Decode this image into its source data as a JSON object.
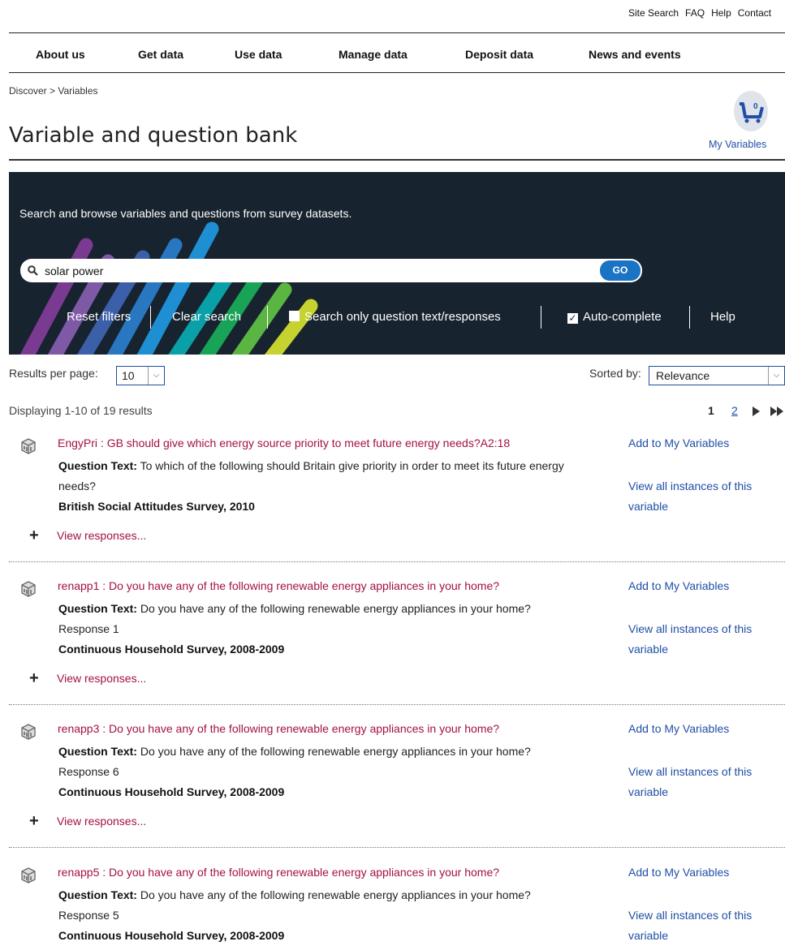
{
  "util_nav": [
    "Site Search",
    "FAQ",
    "Help",
    "Contact"
  ],
  "main_nav": [
    "About us",
    "Get data",
    "Use data",
    "Manage data",
    "Deposit data",
    "News and events"
  ],
  "breadcrumb": "Discover > Variables",
  "page_title": "Variable and question bank",
  "cart": {
    "count": "0",
    "label": "My Variables"
  },
  "banner": {
    "intro": "Search and browse variables and questions from survey datasets."
  },
  "search": {
    "value": "solar power",
    "go_label": "GO"
  },
  "controls": {
    "reset": "Reset filters",
    "clear": "Clear search",
    "question_only": "Search only question text/responses",
    "question_only_checked": false,
    "autocomplete": "Auto-complete",
    "autocomplete_checked": true,
    "help": "Help"
  },
  "results_per_page": {
    "label": "Results per page:",
    "value": "10"
  },
  "sorted_by": {
    "label": "Sorted by:",
    "value": "Relevance"
  },
  "displaying": "Displaying 1-10 of 19 results",
  "pagination": {
    "current": "1",
    "next": "2"
  },
  "results": [
    {
      "title": "EngyPri : GB should give which energy source priority to meet future energy needs?A2:18",
      "qlabel": "Question Text:",
      "qtext": "To which of the following should Britain give priority in order to meet its future energy needs?",
      "response": "",
      "survey": "British Social Attitudes Survey, 2010",
      "add": "Add to My Variables",
      "view_all": "View all instances of this variable",
      "view_responses": "View responses..."
    },
    {
      "title": "renapp1 : Do you have any of the following renewable energy appliances in your home?",
      "qlabel": "Question Text:",
      "qtext": "Do you have any of the following renewable energy appliances in your home?",
      "response": "Response 1",
      "survey": "Continuous Household Survey, 2008-2009",
      "add": "Add to My Variables",
      "view_all": "View all instances of this variable",
      "view_responses": "View responses..."
    },
    {
      "title": "renapp3 : Do you have any of the following renewable energy appliances in your home?",
      "qlabel": "Question Text:",
      "qtext": "Do you have any of the following renewable energy appliances in your home?",
      "response": "Response 6",
      "survey": "Continuous Household Survey, 2008-2009",
      "add": "Add to My Variables",
      "view_all": "View all instances of this variable",
      "view_responses": "View responses..."
    },
    {
      "title": "renapp5 : Do you have any of the following renewable energy appliances in your home?",
      "qlabel": "Question Text:",
      "qtext": "Do you have any of the following renewable energy appliances in your home?",
      "response": "Response 5",
      "survey": "Continuous Household Survey, 2008-2009",
      "add": "Add to My Variables",
      "view_all": "View all instances of this variable",
      "view_responses": ""
    }
  ]
}
